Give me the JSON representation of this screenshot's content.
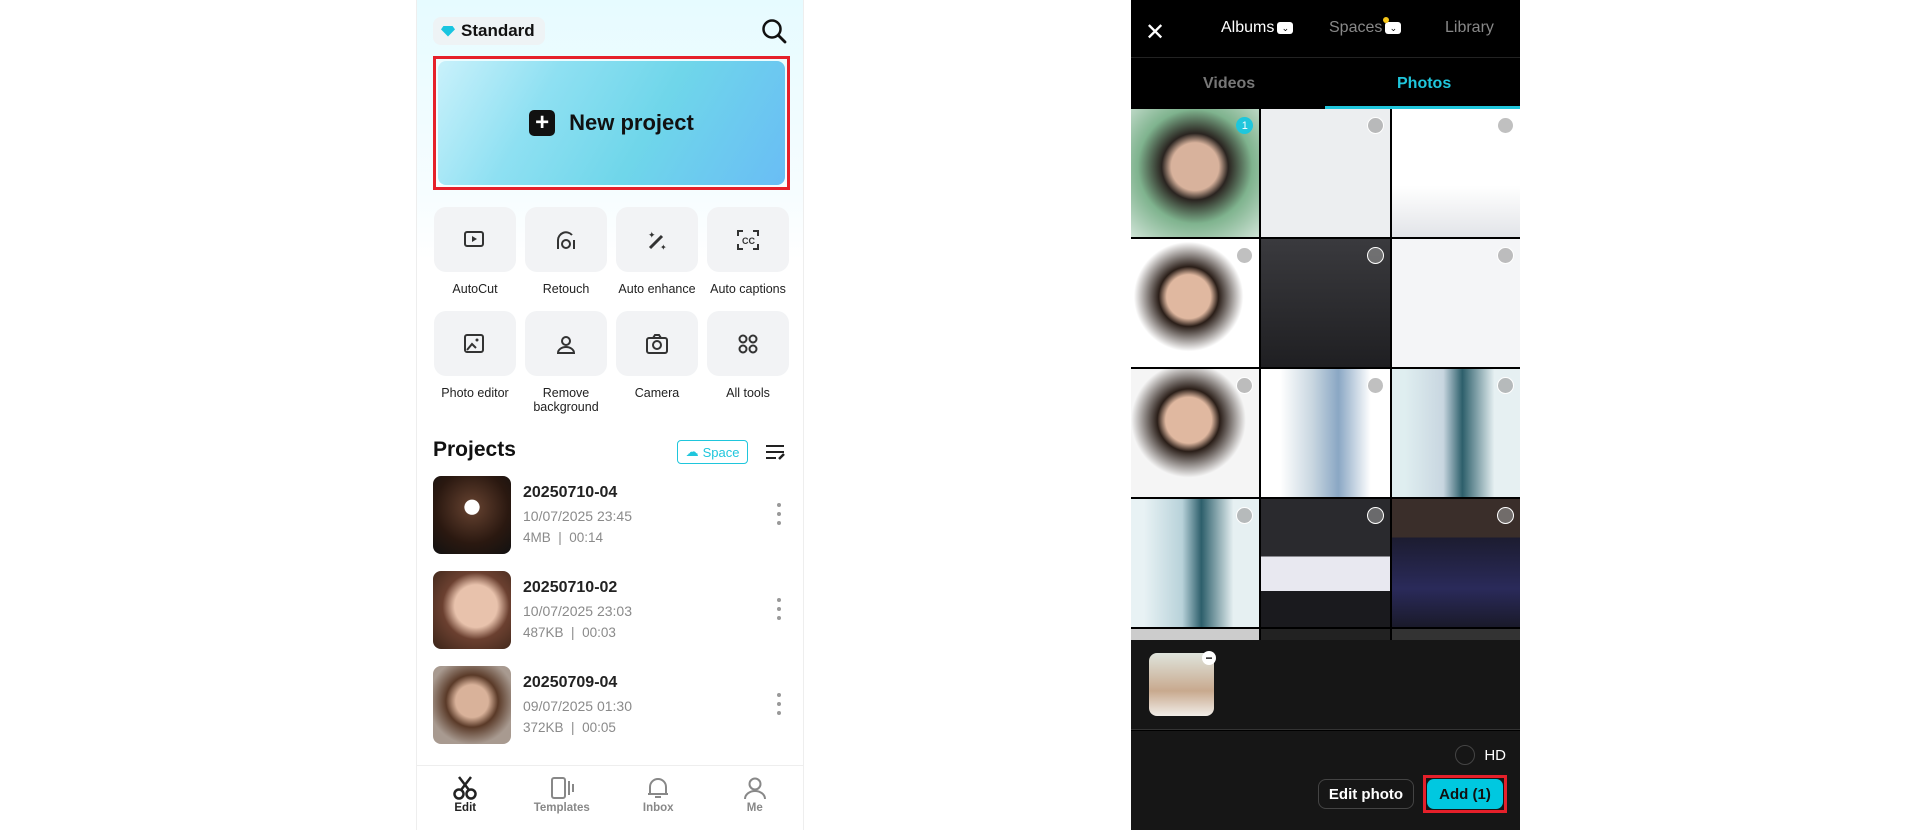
{
  "home": {
    "plan_label": "Standard",
    "new_project_label": "New project",
    "tools": [
      {
        "label": "AutoCut",
        "icon": "autocut-icon"
      },
      {
        "label": "Retouch",
        "icon": "retouch-icon"
      },
      {
        "label": "Auto enhance",
        "icon": "magic-wand-icon"
      },
      {
        "label": "Auto captions",
        "icon": "captions-icon"
      },
      {
        "label": "Photo editor",
        "icon": "photo-edit-icon"
      },
      {
        "label": "Remove background",
        "icon": "remove-bg-icon"
      },
      {
        "label": "Camera",
        "icon": "camera-icon"
      },
      {
        "label": "All tools",
        "icon": "grid-icon"
      }
    ],
    "projects_title": "Projects",
    "space_label": "Space",
    "projects": [
      {
        "name": "20250710-04",
        "date": "10/07/2025 23:45",
        "size": "4MB",
        "duration": "00:14"
      },
      {
        "name": "20250710-02",
        "date": "10/07/2025 23:03",
        "size": "487KB",
        "duration": "00:03"
      },
      {
        "name": "20250709-04",
        "date": "09/07/2025 01:30",
        "size": "372KB",
        "duration": "00:05"
      }
    ],
    "nav": [
      {
        "label": "Edit"
      },
      {
        "label": "Templates"
      },
      {
        "label": "Inbox"
      },
      {
        "label": "Me"
      }
    ]
  },
  "picker": {
    "top_tabs": [
      "Albums",
      "Spaces",
      "Library"
    ],
    "media_tabs": [
      "Videos",
      "Photos"
    ],
    "active_media_tab": "Photos",
    "selected_badge": "1",
    "hd_label": "HD",
    "edit_photo_label": "Edit photo",
    "add_label": "Add (1)",
    "accent": "#00c8e0"
  }
}
